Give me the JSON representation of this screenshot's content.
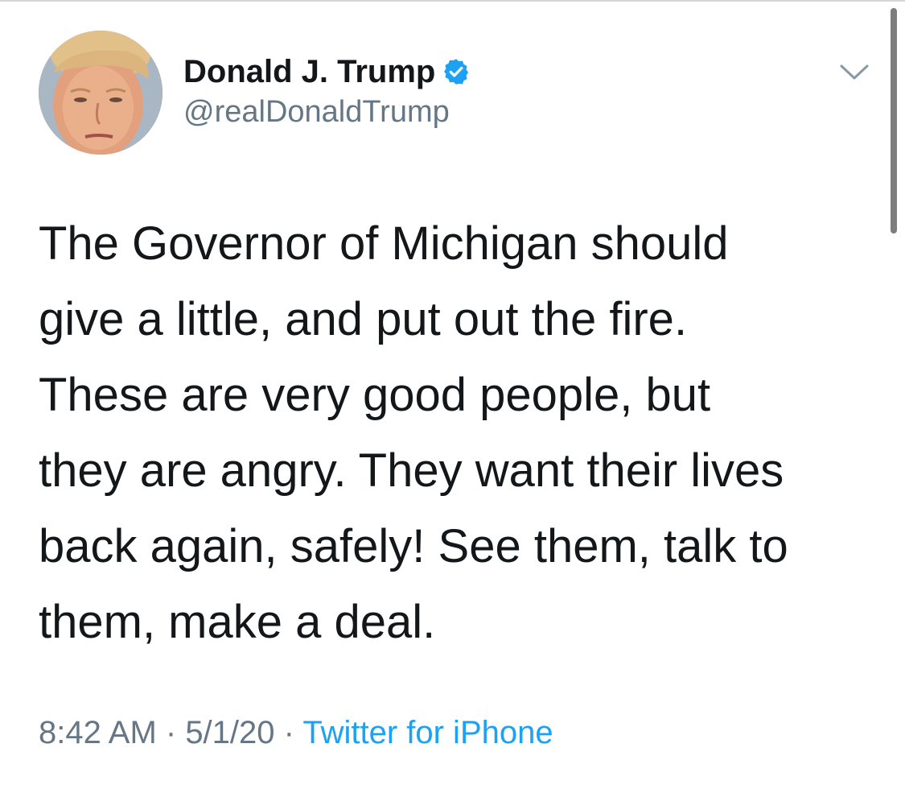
{
  "tweet": {
    "author": {
      "display_name": "Donald J. Trump",
      "handle": "@realDonaldTrump",
      "verified": true,
      "avatar_icon": "profile-photo"
    },
    "text": "The Governor of Michigan should\ngive a little, and put out the fire.\nThese are very good people, but\nthey are angry. They want their lives\nback again, safely! See them, talk to\nthem, make a deal.",
    "meta": {
      "time": "8:42 AM",
      "separator": " · ",
      "date": "5/1/20",
      "source": "Twitter for iPhone"
    },
    "menu_icon": "chevron-down-icon"
  },
  "colors": {
    "text_primary": "#14171a",
    "text_secondary": "#657786",
    "accent": "#1da1f2",
    "verified_badge": "#1da1f2"
  }
}
